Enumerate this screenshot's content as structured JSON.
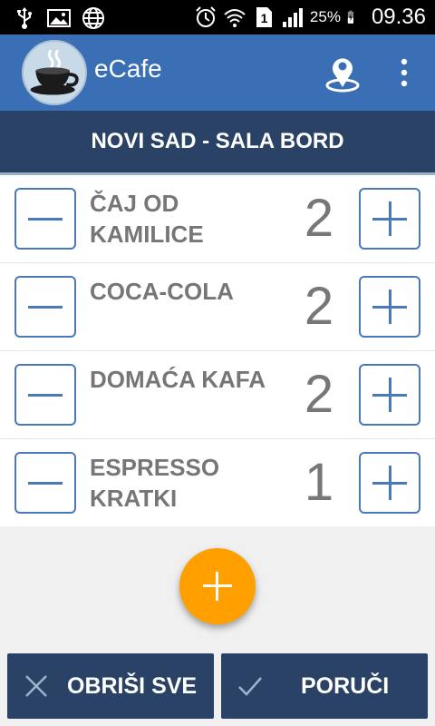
{
  "status_bar": {
    "battery": "25%",
    "time": "09.36",
    "sim": "1",
    "icons": [
      "usb-icon",
      "image-icon",
      "globe-icon",
      "alarm-icon",
      "wifi-icon",
      "sim-icon",
      "signal-icon",
      "battery-charging-icon"
    ]
  },
  "app_bar": {
    "title": "eCafe",
    "logo_icon": "coffee-cup-logo",
    "actions": [
      "location-pin-icon",
      "overflow-menu-icon"
    ]
  },
  "venue": {
    "title": "NOVI SAD - SALA BORD"
  },
  "items": [
    {
      "name": "ČAJ OD KAMILICE",
      "qty": "2"
    },
    {
      "name": "COCA-COLA",
      "qty": "2"
    },
    {
      "name": "DOMAĆA KAFA",
      "qty": "2"
    },
    {
      "name": "ESPRESSO KRATKI",
      "qty": "1"
    }
  ],
  "fab": {
    "icon": "plus-icon"
  },
  "buttons": {
    "clear_label": "OBRIŠI SVE",
    "order_label": "PORUČI"
  },
  "colors": {
    "app_bar": "#3a6eb5",
    "venue_bar": "#2a4266",
    "accent_fab": "#ffa000",
    "button_outline": "#4a79b7"
  }
}
